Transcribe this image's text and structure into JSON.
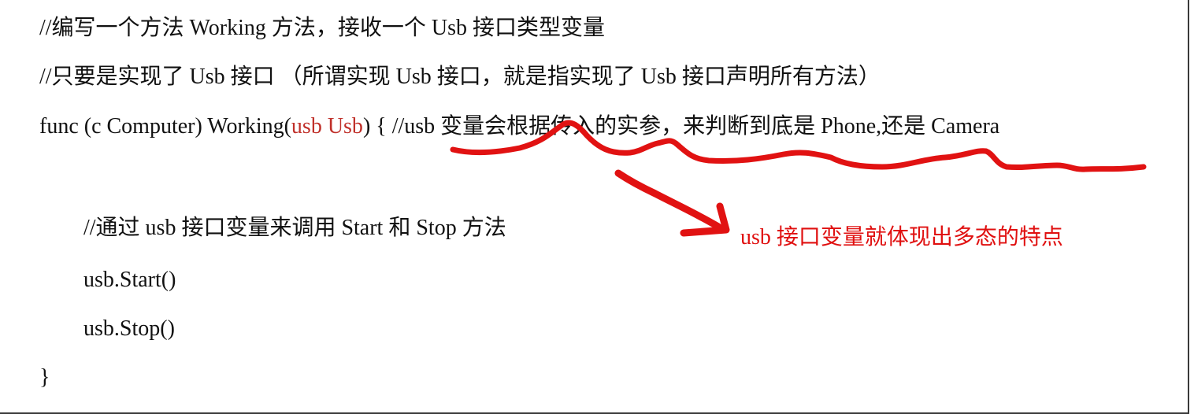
{
  "code": {
    "comment1": "//编写一个方法 Working  方法，接收一个 Usb 接口类型变量",
    "comment2": "//只要是实现了  Usb 接口 （所谓实现 Usb 接口，就是指实现了  Usb 接口声明所有方法）",
    "func_prefix": "func (c Computer) Working(",
    "func_param": "usb Usb",
    "func_suffix": ") { //usb  变量会根据传入的实参，来判断到底是 Phone,还是 Camera",
    "comment3": "//通过 usb 接口变量来调用 Start 和 Stop 方法",
    "call_start": "usb.Start()",
    "call_stop": "usb.Stop()",
    "closing_brace": "}"
  },
  "annotation": {
    "text": "usb  接口变量就体现出多态的特点",
    "color": "#e01010"
  }
}
